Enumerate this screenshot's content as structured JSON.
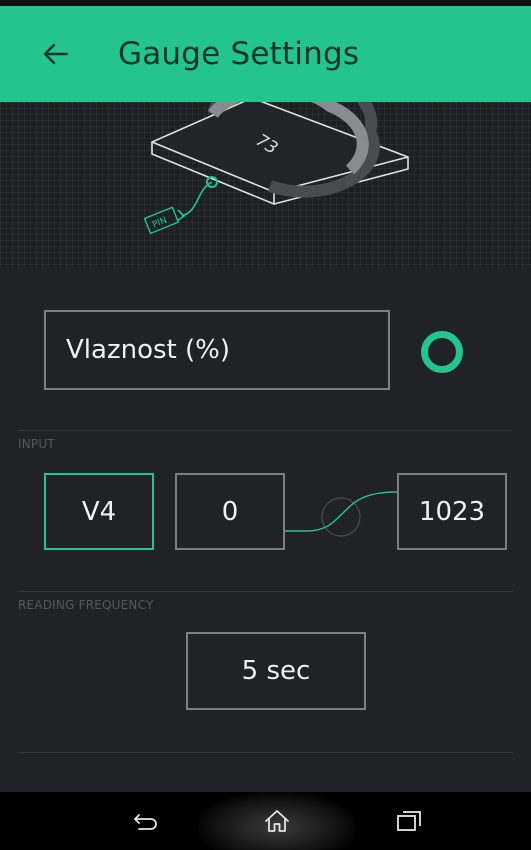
{
  "appbar": {
    "title": "Gauge Settings",
    "back_icon": "arrow-left-icon",
    "background": "#23c48e"
  },
  "hero": {
    "gauge_value": "73",
    "pin_label": "PIN"
  },
  "widget": {
    "name_value": "Vlaznost (%)",
    "color": "#23c48e"
  },
  "input": {
    "section_label": "INPUT",
    "pin": "V4",
    "min": "0",
    "max": "1023"
  },
  "reading_frequency": {
    "section_label": "READING FREQUENCY",
    "value": "5 sec"
  },
  "navbar": {
    "back_icon": "nav-back-icon",
    "home_icon": "nav-home-icon",
    "recents_icon": "nav-recents-icon"
  }
}
